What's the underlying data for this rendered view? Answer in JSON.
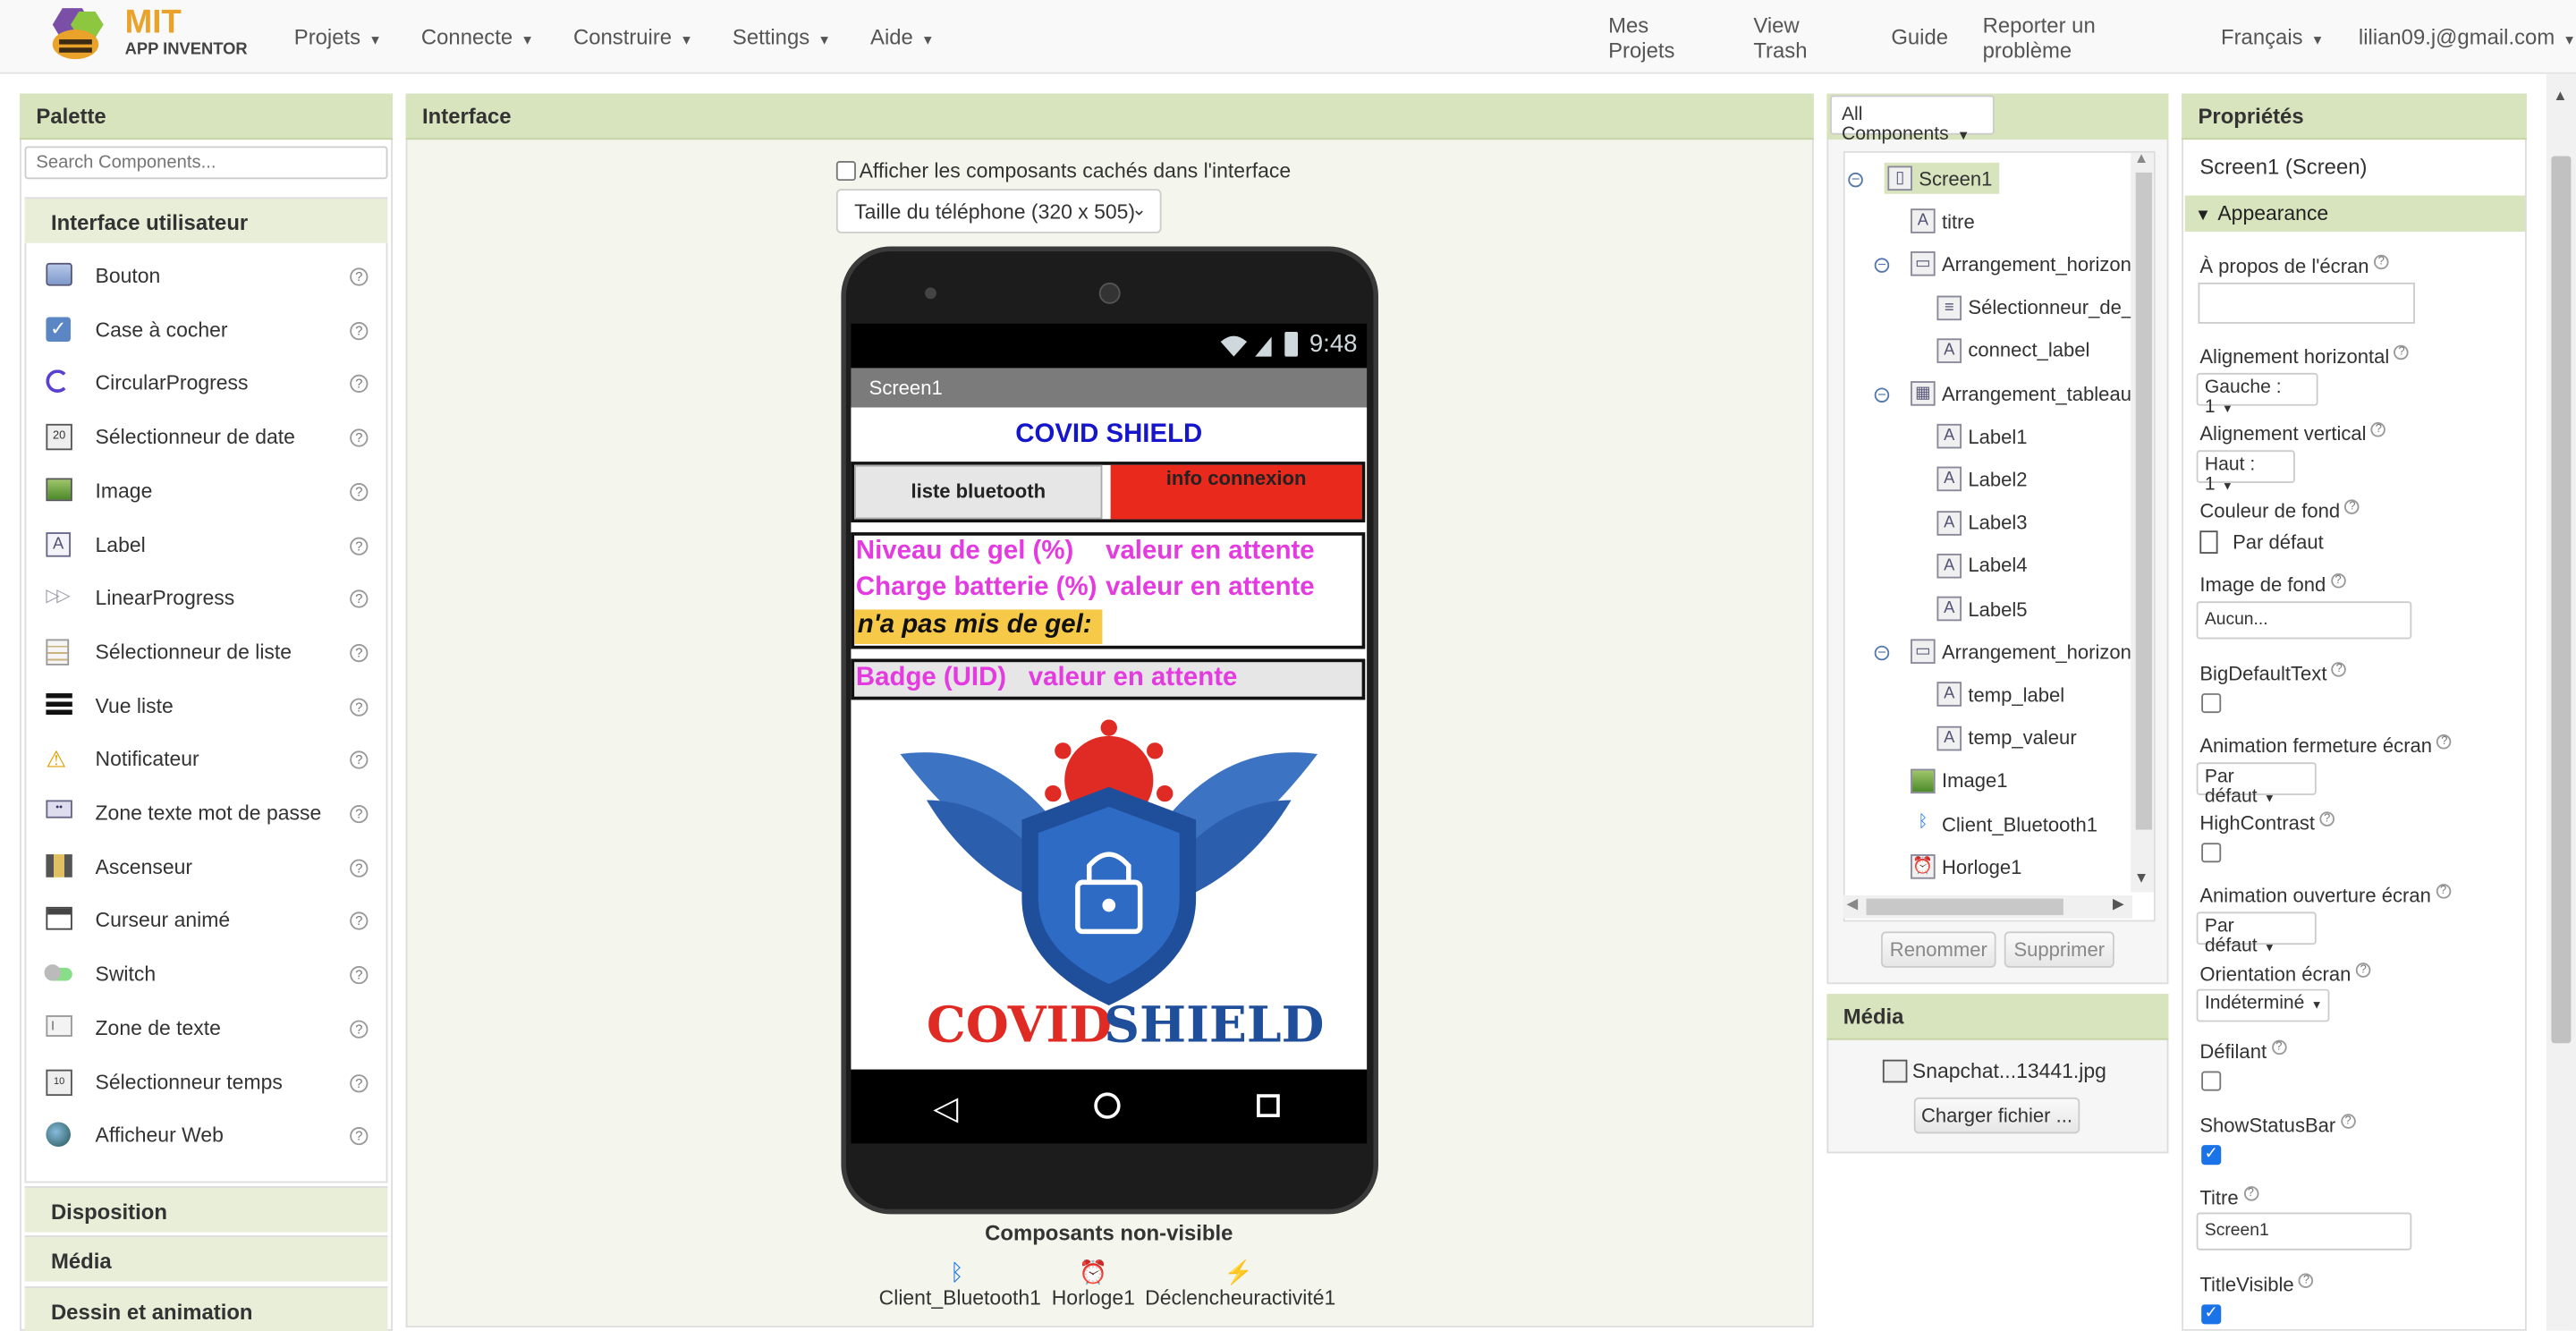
{
  "topbar": {
    "logo_line1": "MIT",
    "logo_line2": "APP INVENTOR",
    "menus": [
      "Projets",
      "Connecte",
      "Construire",
      "Settings",
      "Aide"
    ],
    "right_links": [
      "Mes Projets",
      "View Trash",
      "Guide",
      "Reporter un problème"
    ],
    "language": "Français",
    "account": "lilian09.j@gmail.com"
  },
  "palette": {
    "title": "Palette",
    "search_placeholder": "Search Components...",
    "category_open": "Interface utilisateur",
    "items": [
      {
        "label": "Bouton",
        "icon": "button-icon"
      },
      {
        "label": "Case à cocher",
        "icon": "checkbox-icon"
      },
      {
        "label": "CircularProgress",
        "icon": "circular-progress-icon"
      },
      {
        "label": "Sélectionneur de date",
        "icon": "date-picker-icon"
      },
      {
        "label": "Image",
        "icon": "image-icon"
      },
      {
        "label": "Label",
        "icon": "label-icon"
      },
      {
        "label": "LinearProgress",
        "icon": "linear-progress-icon"
      },
      {
        "label": "Sélectionneur de liste",
        "icon": "list-picker-icon"
      },
      {
        "label": "Vue liste",
        "icon": "list-view-icon"
      },
      {
        "label": "Notificateur",
        "icon": "notifier-icon"
      },
      {
        "label": "Zone texte mot de passe",
        "icon": "password-textbox-icon"
      },
      {
        "label": "Ascenseur",
        "icon": "slider-icon"
      },
      {
        "label": "Curseur animé",
        "icon": "spinner-icon"
      },
      {
        "label": "Switch",
        "icon": "switch-icon"
      },
      {
        "label": "Zone de texte",
        "icon": "textbox-icon"
      },
      {
        "label": "Sélectionneur temps",
        "icon": "time-picker-icon"
      },
      {
        "label": "Afficheur Web",
        "icon": "web-viewer-icon"
      }
    ],
    "categories": [
      "Disposition",
      "Média",
      "Dessin et animation"
    ]
  },
  "viewer": {
    "title": "Interface",
    "show_hidden_label": "Afficher les composants cachés dans l'interface",
    "phone_size": "Taille du téléphone (320 x 505)",
    "status_time": "9:48",
    "screen_title": "Screen1",
    "app_title": "COVID SHIELD",
    "btn_list": "liste bluetooth",
    "btn_info": "info connexion",
    "rows": [
      {
        "label": "Niveau de gel (%)",
        "value": "valeur en attente"
      },
      {
        "label": "Charge batterie (%)",
        "value": "valeur en attente"
      }
    ],
    "gel_label": "n'a pas mis de gel:",
    "badge_label": "Badge (UID)",
    "badge_value": "valeur en attente",
    "logo_text_1": "COVID",
    "logo_text_2": "SHIELD",
    "nonvisible_title": "Composants non-visible",
    "nonvisible": [
      {
        "label": "Client_Bluetooth1",
        "icon": "bluetooth-icon"
      },
      {
        "label": "Horloge1",
        "icon": "clock-icon"
      },
      {
        "label": "Déclencheuractivité1",
        "icon": "activity-starter-icon"
      }
    ]
  },
  "components": {
    "dropdown": "All Components",
    "tree": [
      {
        "label": "Screen1",
        "level": 0,
        "icon": "screen-icon",
        "selected": true,
        "toggle": true
      },
      {
        "label": "titre",
        "level": 1,
        "icon": "label-icon"
      },
      {
        "label": "Arrangement_horizont",
        "level": 1,
        "icon": "horizontal-arrangement-icon",
        "toggle": true
      },
      {
        "label": "Sélectionneur_de_l",
        "level": 2,
        "icon": "list-picker-icon"
      },
      {
        "label": "connect_label",
        "level": 2,
        "icon": "label-icon"
      },
      {
        "label": "Arrangement_tableau",
        "level": 1,
        "icon": "table-arrangement-icon",
        "toggle": true
      },
      {
        "label": "Label1",
        "level": 2,
        "icon": "label-icon"
      },
      {
        "label": "Label2",
        "level": 2,
        "icon": "label-icon"
      },
      {
        "label": "Label3",
        "level": 2,
        "icon": "label-icon"
      },
      {
        "label": "Label4",
        "level": 2,
        "icon": "label-icon"
      },
      {
        "label": "Label5",
        "level": 2,
        "icon": "label-icon"
      },
      {
        "label": "Arrangement_horizont",
        "level": 1,
        "icon": "horizontal-arrangement-icon",
        "toggle": true
      },
      {
        "label": "temp_label",
        "level": 2,
        "icon": "label-icon"
      },
      {
        "label": "temp_valeur",
        "level": 2,
        "icon": "label-icon"
      },
      {
        "label": "Image1",
        "level": 1,
        "icon": "image-icon"
      },
      {
        "label": "Client_Bluetooth1",
        "level": 1,
        "icon": "bluetooth-icon"
      },
      {
        "label": "Horloge1",
        "level": 1,
        "icon": "clock-icon"
      }
    ],
    "rename": "Renommer",
    "delete": "Supprimer"
  },
  "media": {
    "title": "Média",
    "file": "Snapchat...13441.jpg",
    "upload": "Charger fichier ..."
  },
  "properties": {
    "title": "Propriétés",
    "subtitle": "Screen1 (Screen)",
    "section": "Appearance",
    "about": "À propos de l'écran",
    "align_h": "Alignement horizontal",
    "align_h_val": "Gauche : 1",
    "align_v": "Alignement vertical",
    "align_v_val": "Haut : 1",
    "bg_color": "Couleur de fond",
    "bg_color_val": "Par défaut",
    "bg_image": "Image de fond",
    "bg_image_val": "Aucun...",
    "big_text": "BigDefaultText",
    "close_anim": "Animation fermeture écran",
    "close_anim_val": "Par défaut",
    "high_contrast": "HighContrast",
    "open_anim": "Animation ouverture écran",
    "open_anim_val": "Par défaut",
    "orientation": "Orientation écran",
    "orientation_val": "Indéterminé",
    "scrollable": "Défilant",
    "status_bar": "ShowStatusBar",
    "title_label": "Titre",
    "title_val": "Screen1",
    "title_visible": "TitleVisible"
  },
  "colors": {
    "header_green": "#d7e4bd",
    "pink": "#e33be0",
    "blue_title": "#1515cc",
    "red_btn": "#e8291c",
    "yellow": "#f7c948"
  }
}
